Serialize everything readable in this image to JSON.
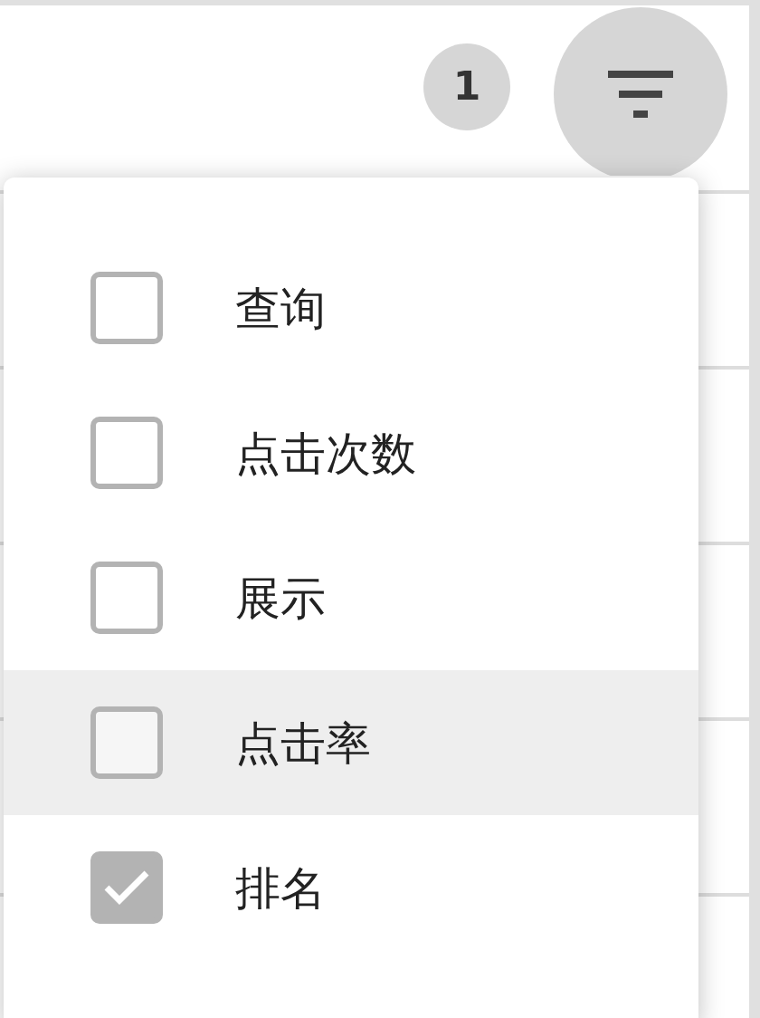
{
  "toolbar": {
    "filter_count": "1"
  },
  "filter_menu": {
    "options": [
      {
        "label": "查询",
        "checked": false,
        "highlighted": false
      },
      {
        "label": "点击次数",
        "checked": false,
        "highlighted": false
      },
      {
        "label": "展示",
        "checked": false,
        "highlighted": false
      },
      {
        "label": "点击率",
        "checked": false,
        "highlighted": true
      },
      {
        "label": "排名",
        "checked": true,
        "highlighted": false
      }
    ]
  }
}
